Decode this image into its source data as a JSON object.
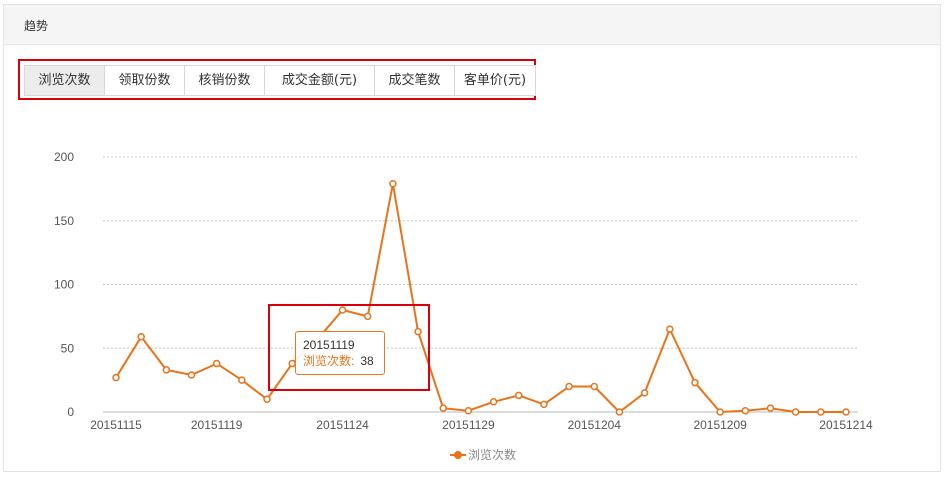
{
  "header": {
    "title": "趋势"
  },
  "tabs": [
    {
      "label": "浏览次数",
      "active": true
    },
    {
      "label": "领取份数",
      "active": false
    },
    {
      "label": "核销份数",
      "active": false
    },
    {
      "label": "成交金额(元)",
      "active": false
    },
    {
      "label": "成交笔数",
      "active": false
    },
    {
      "label": "客单价(元)",
      "active": false
    }
  ],
  "tooltip": {
    "date": "20151119",
    "series_label": "浏览次数:",
    "value": "38"
  },
  "legend": {
    "label": "浏览次数"
  },
  "colors": {
    "series": "#e8731a",
    "highlight": "#d9000c"
  },
  "chart_data": {
    "type": "line",
    "x": [
      "20151115",
      "20151116",
      "20151117",
      "20151118",
      "20151119",
      "20151120",
      "20151121",
      "20151122",
      "20151123",
      "20151124",
      "20151125",
      "20151126",
      "20151127",
      "20151128",
      "20151129",
      "20151130",
      "20151201",
      "20151202",
      "20151203",
      "20151204",
      "20151205",
      "20151206",
      "20151207",
      "20151208",
      "20151209",
      "20151210",
      "20151211",
      "20151212",
      "20151213",
      "20151214"
    ],
    "x_tick_labels": [
      "20151115",
      "20151119",
      "20151124",
      "20151129",
      "20151204",
      "20151209",
      "20151214"
    ],
    "series": [
      {
        "name": "浏览次数",
        "values": [
          27,
          59,
          33,
          29,
          38,
          25,
          10,
          38,
          57,
          80,
          75,
          179,
          63,
          3,
          1,
          8,
          13,
          6,
          20,
          20,
          0,
          15,
          65,
          23,
          0,
          1,
          3,
          0,
          0,
          0
        ]
      }
    ],
    "yticks": [
      0,
      50,
      100,
      150,
      200
    ],
    "ylim": [
      0,
      200
    ],
    "grid": true,
    "legend_position": "bottom-center"
  }
}
